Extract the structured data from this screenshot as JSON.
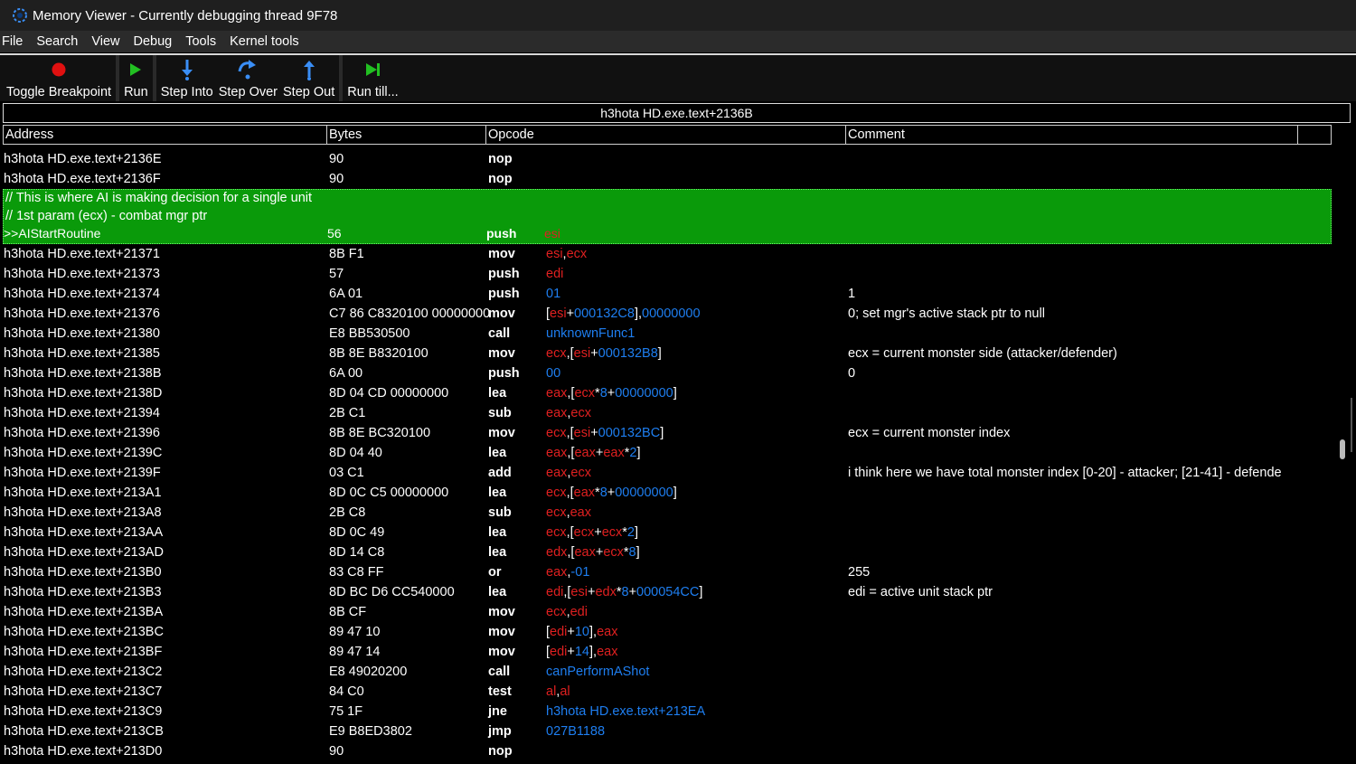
{
  "window": {
    "title": "Memory Viewer - Currently debugging thread 9F78"
  },
  "menu": [
    "File",
    "Search",
    "View",
    "Debug",
    "Tools",
    "Kernel tools"
  ],
  "toolbar": {
    "toggle_breakpoint": "Toggle Breakpoint",
    "run": "Run",
    "step_into": "Step Into",
    "step_over": "Step Over",
    "step_out": "Step Out",
    "run_till": "Run till..."
  },
  "address_bar": "h3hota HD.exe.text+2136B",
  "columns": {
    "address": "Address",
    "bytes": "Bytes",
    "opcode": "Opcode",
    "comment": "Comment"
  },
  "highlight": {
    "comment1": "// This is where AI is making decision for a single unit",
    "comment2": "// 1st param (ecx) - combat mgr ptr",
    "label": ">>AIStartRoutine",
    "bytes": "56",
    "op": "push",
    "arg": "esi"
  },
  "rows_before": [
    {
      "addr": "h3hota HD.exe.text+2136E",
      "bytes": "90",
      "op": "nop",
      "args": [],
      "comment": ""
    },
    {
      "addr": "h3hota HD.exe.text+2136F",
      "bytes": "90",
      "op": "nop",
      "args": [],
      "comment": ""
    }
  ],
  "rows": [
    {
      "addr": "h3hota HD.exe.text+21371",
      "bytes": "8B F1",
      "op": "mov",
      "args": [
        [
          "reg",
          "esi"
        ],
        [
          "p",
          ","
        ],
        [
          "reg",
          "ecx"
        ]
      ],
      "comment": ""
    },
    {
      "addr": "h3hota HD.exe.text+21373",
      "bytes": "57",
      "op": "push",
      "args": [
        [
          "reg",
          "edi"
        ]
      ],
      "comment": ""
    },
    {
      "addr": "h3hota HD.exe.text+21374",
      "bytes": "6A 01",
      "op": "push",
      "args": [
        [
          "num",
          "01"
        ]
      ],
      "comment": "1"
    },
    {
      "addr": "h3hota HD.exe.text+21376",
      "bytes": "C7 86 C8320100 00000000",
      "op": "mov",
      "args": [
        [
          "p",
          "["
        ],
        [
          "reg",
          "esi"
        ],
        [
          "p",
          "+"
        ],
        [
          "num",
          "000132C8"
        ],
        [
          "p",
          "],"
        ],
        [
          "num",
          "00000000"
        ]
      ],
      "comment": "0; set mgr's active stack ptr to null"
    },
    {
      "addr": "h3hota HD.exe.text+21380",
      "bytes": "E8 BB530500",
      "op": "call",
      "args": [
        [
          "sym",
          "unknownFunc1"
        ]
      ],
      "comment": ""
    },
    {
      "addr": "h3hota HD.exe.text+21385",
      "bytes": "8B 8E B8320100",
      "op": "mov",
      "args": [
        [
          "reg",
          "ecx"
        ],
        [
          "p",
          ",["
        ],
        [
          "reg",
          "esi"
        ],
        [
          "p",
          "+"
        ],
        [
          "num",
          "000132B8"
        ],
        [
          "p",
          "]"
        ]
      ],
      "comment": "ecx = current monster side (attacker/defender)"
    },
    {
      "addr": "h3hota HD.exe.text+2138B",
      "bytes": "6A 00",
      "op": "push",
      "args": [
        [
          "num",
          "00"
        ]
      ],
      "comment": "0"
    },
    {
      "addr": "h3hota HD.exe.text+2138D",
      "bytes": "8D 04 CD 00000000",
      "op": "lea",
      "args": [
        [
          "reg",
          "eax"
        ],
        [
          "p",
          ",["
        ],
        [
          "reg",
          "ecx"
        ],
        [
          "p",
          "*"
        ],
        [
          "num",
          "8"
        ],
        [
          "p",
          "+"
        ],
        [
          "num",
          "00000000"
        ],
        [
          "p",
          "]"
        ]
      ],
      "comment": ""
    },
    {
      "addr": "h3hota HD.exe.text+21394",
      "bytes": "2B C1",
      "op": "sub",
      "args": [
        [
          "reg",
          "eax"
        ],
        [
          "p",
          ","
        ],
        [
          "reg",
          "ecx"
        ]
      ],
      "comment": ""
    },
    {
      "addr": "h3hota HD.exe.text+21396",
      "bytes": "8B 8E BC320100",
      "op": "mov",
      "args": [
        [
          "reg",
          "ecx"
        ],
        [
          "p",
          ",["
        ],
        [
          "reg",
          "esi"
        ],
        [
          "p",
          "+"
        ],
        [
          "num",
          "000132BC"
        ],
        [
          "p",
          "]"
        ]
      ],
      "comment": "ecx = current monster index"
    },
    {
      "addr": "h3hota HD.exe.text+2139C",
      "bytes": "8D 04 40",
      "op": "lea",
      "args": [
        [
          "reg",
          "eax"
        ],
        [
          "p",
          ",["
        ],
        [
          "reg",
          "eax"
        ],
        [
          "p",
          "+"
        ],
        [
          "reg",
          "eax"
        ],
        [
          "p",
          "*"
        ],
        [
          "num",
          "2"
        ],
        [
          "p",
          "]"
        ]
      ],
      "comment": ""
    },
    {
      "addr": "h3hota HD.exe.text+2139F",
      "bytes": "03 C1",
      "op": "add",
      "args": [
        [
          "reg",
          "eax"
        ],
        [
          "p",
          ","
        ],
        [
          "reg",
          "ecx"
        ]
      ],
      "comment": "i think here we have total monster index [0-20] - attacker; [21-41] - defende"
    },
    {
      "addr": "h3hota HD.exe.text+213A1",
      "bytes": "8D 0C C5 00000000",
      "op": "lea",
      "args": [
        [
          "reg",
          "ecx"
        ],
        [
          "p",
          ",["
        ],
        [
          "reg",
          "eax"
        ],
        [
          "p",
          "*"
        ],
        [
          "num",
          "8"
        ],
        [
          "p",
          "+"
        ],
        [
          "num",
          "00000000"
        ],
        [
          "p",
          "]"
        ]
      ],
      "comment": ""
    },
    {
      "addr": "h3hota HD.exe.text+213A8",
      "bytes": "2B C8",
      "op": "sub",
      "args": [
        [
          "reg",
          "ecx"
        ],
        [
          "p",
          ","
        ],
        [
          "reg",
          "eax"
        ]
      ],
      "comment": ""
    },
    {
      "addr": "h3hota HD.exe.text+213AA",
      "bytes": "8D 0C 49",
      "op": "lea",
      "args": [
        [
          "reg",
          "ecx"
        ],
        [
          "p",
          ",["
        ],
        [
          "reg",
          "ecx"
        ],
        [
          "p",
          "+"
        ],
        [
          "reg",
          "ecx"
        ],
        [
          "p",
          "*"
        ],
        [
          "num",
          "2"
        ],
        [
          "p",
          "]"
        ]
      ],
      "comment": ""
    },
    {
      "addr": "h3hota HD.exe.text+213AD",
      "bytes": "8D 14 C8",
      "op": "lea",
      "args": [
        [
          "reg",
          "edx"
        ],
        [
          "p",
          ",["
        ],
        [
          "reg",
          "eax"
        ],
        [
          "p",
          "+"
        ],
        [
          "reg",
          "ecx"
        ],
        [
          "p",
          "*"
        ],
        [
          "num",
          "8"
        ],
        [
          "p",
          "]"
        ]
      ],
      "comment": ""
    },
    {
      "addr": "h3hota HD.exe.text+213B0",
      "bytes": "83 C8 FF",
      "op": "or",
      "args": [
        [
          "reg",
          "eax"
        ],
        [
          "p",
          ","
        ],
        [
          "num",
          "-01"
        ]
      ],
      "comment": "255"
    },
    {
      "addr": "h3hota HD.exe.text+213B3",
      "bytes": "8D BC D6 CC540000",
      "op": "lea",
      "args": [
        [
          "reg",
          "edi"
        ],
        [
          "p",
          ",["
        ],
        [
          "reg",
          "esi"
        ],
        [
          "p",
          "+"
        ],
        [
          "reg",
          "edx"
        ],
        [
          "p",
          "*"
        ],
        [
          "num",
          "8"
        ],
        [
          "p",
          "+"
        ],
        [
          "num",
          "000054CC"
        ],
        [
          "p",
          "]"
        ]
      ],
      "comment": "edi = active unit stack ptr"
    },
    {
      "addr": "h3hota HD.exe.text+213BA",
      "bytes": "8B CF",
      "op": "mov",
      "args": [
        [
          "reg",
          "ecx"
        ],
        [
          "p",
          ","
        ],
        [
          "reg",
          "edi"
        ]
      ],
      "comment": ""
    },
    {
      "addr": "h3hota HD.exe.text+213BC",
      "bytes": "89 47 10",
      "op": "mov",
      "args": [
        [
          "p",
          "["
        ],
        [
          "reg",
          "edi"
        ],
        [
          "p",
          "+"
        ],
        [
          "num",
          "10"
        ],
        [
          "p",
          "],"
        ],
        [
          "reg",
          "eax"
        ]
      ],
      "comment": ""
    },
    {
      "addr": "h3hota HD.exe.text+213BF",
      "bytes": "89 47 14",
      "op": "mov",
      "args": [
        [
          "p",
          "["
        ],
        [
          "reg",
          "edi"
        ],
        [
          "p",
          "+"
        ],
        [
          "num",
          "14"
        ],
        [
          "p",
          "],"
        ],
        [
          "reg",
          "eax"
        ]
      ],
      "comment": ""
    },
    {
      "addr": "h3hota HD.exe.text+213C2",
      "bytes": "E8 49020200",
      "op": "call",
      "args": [
        [
          "sym",
          "canPerformAShot"
        ]
      ],
      "comment": ""
    },
    {
      "addr": "h3hota HD.exe.text+213C7",
      "bytes": "84 C0",
      "op": "test",
      "args": [
        [
          "reg",
          "al"
        ],
        [
          "p",
          ","
        ],
        [
          "reg",
          "al"
        ]
      ],
      "comment": ""
    },
    {
      "addr": "h3hota HD.exe.text+213C9",
      "bytes": "75 1F",
      "op": "jne",
      "args": [
        [
          "sym",
          "h3hota HD.exe.text+213EA"
        ]
      ],
      "comment": ""
    },
    {
      "addr": "h3hota HD.exe.text+213CB",
      "bytes": "E9 B8ED3802",
      "op": "jmp",
      "args": [
        [
          "num",
          "027B1188"
        ]
      ],
      "comment": ""
    },
    {
      "addr": "h3hota HD.exe.text+213D0",
      "bytes": "90",
      "op": "nop",
      "args": [],
      "comment": ""
    }
  ],
  "colors": {
    "register": "#e02020",
    "number": "#1e7ef0",
    "highlight_bg": "#0a9a0a",
    "breakpoint": "#e01010",
    "run_arrow": "#22c022",
    "step_icon": "#3a8ef6"
  }
}
